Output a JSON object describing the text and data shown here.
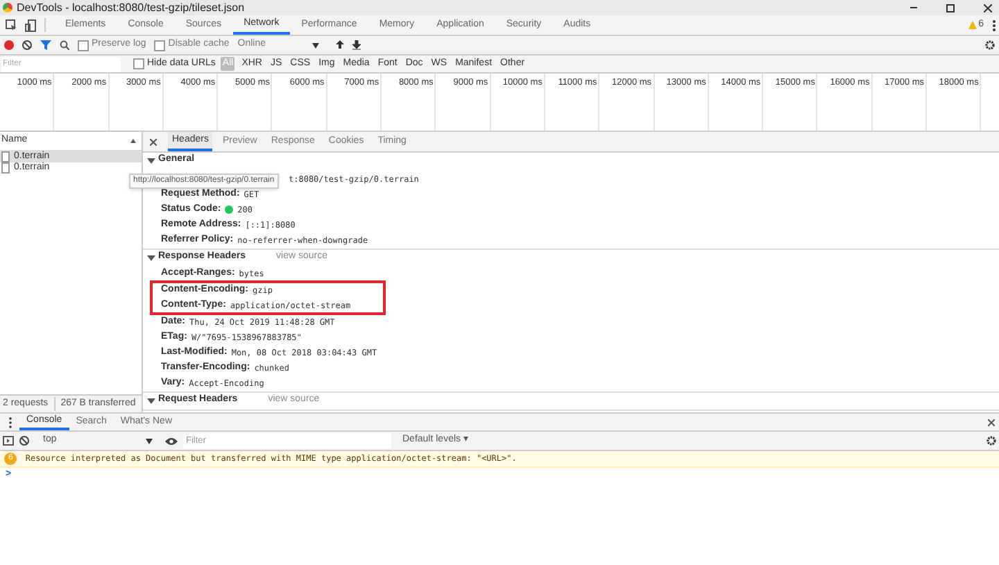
{
  "window": {
    "title": "DevTools - localhost:8080/test-gzip/tileset.json"
  },
  "tabs": [
    {
      "label": "Elements",
      "selected": false
    },
    {
      "label": "Console",
      "selected": false
    },
    {
      "label": "Sources",
      "selected": false
    },
    {
      "label": "Network",
      "selected": true
    },
    {
      "label": "Performance",
      "selected": false
    },
    {
      "label": "Memory",
      "selected": false
    },
    {
      "label": "Application",
      "selected": false
    },
    {
      "label": "Security",
      "selected": false
    },
    {
      "label": "Audits",
      "selected": false
    }
  ],
  "warning_count": "6",
  "toolbar": {
    "recording": true,
    "preserve_log": {
      "label": "Preserve log",
      "checked": false
    },
    "disable_cache": {
      "label": "Disable cache",
      "checked": false
    },
    "throttling": "Online"
  },
  "filter_bar": {
    "placeholder": "Filter",
    "hide_data_urls": {
      "label": "Hide data URLs",
      "checked": false
    },
    "types": [
      {
        "label": "All",
        "selected": true
      },
      {
        "label": "XHR",
        "selected": false
      },
      {
        "label": "JS",
        "selected": false
      },
      {
        "label": "CSS",
        "selected": false
      },
      {
        "label": "Img",
        "selected": false
      },
      {
        "label": "Media",
        "selected": false
      },
      {
        "label": "Font",
        "selected": false
      },
      {
        "label": "Doc",
        "selected": false
      },
      {
        "label": "WS",
        "selected": false
      },
      {
        "label": "Manifest",
        "selected": false
      },
      {
        "label": "Other",
        "selected": false
      }
    ]
  },
  "timeline": [
    "1000 ms",
    "2000 ms",
    "3000 ms",
    "4000 ms",
    "5000 ms",
    "6000 ms",
    "7000 ms",
    "8000 ms",
    "9000 ms",
    "10000 ms",
    "11000 ms",
    "12000 ms",
    "13000 ms",
    "14000 ms",
    "15000 ms",
    "16000 ms",
    "17000 ms",
    "18000 ms"
  ],
  "requests": {
    "column": "Name",
    "rows": [
      {
        "name": "0.terrain",
        "selected": true
      },
      {
        "name": "0.terrain",
        "selected": false
      }
    ]
  },
  "status_bar": [
    "2 requests",
    "267 B transferred"
  ],
  "detail_tabs": [
    {
      "label": "Headers",
      "selected": true
    },
    {
      "label": "Preview",
      "selected": false
    },
    {
      "label": "Response",
      "selected": false
    },
    {
      "label": "Cookies",
      "selected": false
    },
    {
      "label": "Timing",
      "selected": false
    }
  ],
  "tooltip": "http://localhost:8080/test-gzip/0.terrain",
  "sections": [
    {
      "title": "General",
      "expanded": true,
      "rows": [
        {
          "value": "t:8080/test-gzip/0.terrain",
          "highlighted": false
        },
        {
          "key": "Request Method:",
          "value": "GET",
          "highlighted": false
        },
        {
          "key": "Status Code:",
          "value": "200",
          "color": "#22c55e",
          "highlighted": false
        },
        {
          "key": "Remote Address:",
          "value": "[::1]:8080",
          "highlighted": false
        },
        {
          "key": "Referrer Policy:",
          "value": "no-referrer-when-downgrade",
          "highlighted": false
        }
      ]
    },
    {
      "title": "Response Headers",
      "link": "view source",
      "expanded": true,
      "rows": [
        {
          "key": "Accept-Ranges:",
          "value": "bytes",
          "highlighted": false
        },
        {
          "key": "Content-Encoding:",
          "value": "gzip",
          "highlighted": true
        },
        {
          "key": "Content-Type:",
          "value": "application/octet-stream",
          "highlighted": true
        },
        {
          "key": "Date:",
          "value": "Thu, 24 Oct 2019 11:48:28 GMT",
          "highlighted": false
        },
        {
          "key": "ETag:",
          "value": "W/\"7695-1538967883785\"",
          "highlighted": false
        },
        {
          "key": "Last-Modified:",
          "value": "Mon, 08 Oct 2018 03:04:43 GMT",
          "highlighted": false
        },
        {
          "key": "Transfer-Encoding:",
          "value": "chunked",
          "highlighted": false
        },
        {
          "key": "Vary:",
          "value": "Accept-Encoding",
          "highlighted": false
        }
      ]
    },
    {
      "title": "Request Headers",
      "link": "view source",
      "expanded": true
    }
  ],
  "drawer_tabs": [
    {
      "label": "Console",
      "selected": true
    },
    {
      "label": "Search",
      "selected": false
    },
    {
      "label": "What's New",
      "selected": false
    }
  ],
  "console": {
    "context": "top",
    "filter_placeholder": "Filter",
    "levels": "Default levels ▾",
    "messages": [
      {
        "kind": "warning",
        "badge": "6",
        "text": "Resource interpreted as Document but transferred with MIME type application/octet-stream: \"<URL>\"."
      }
    ],
    "prompt": ">"
  }
}
